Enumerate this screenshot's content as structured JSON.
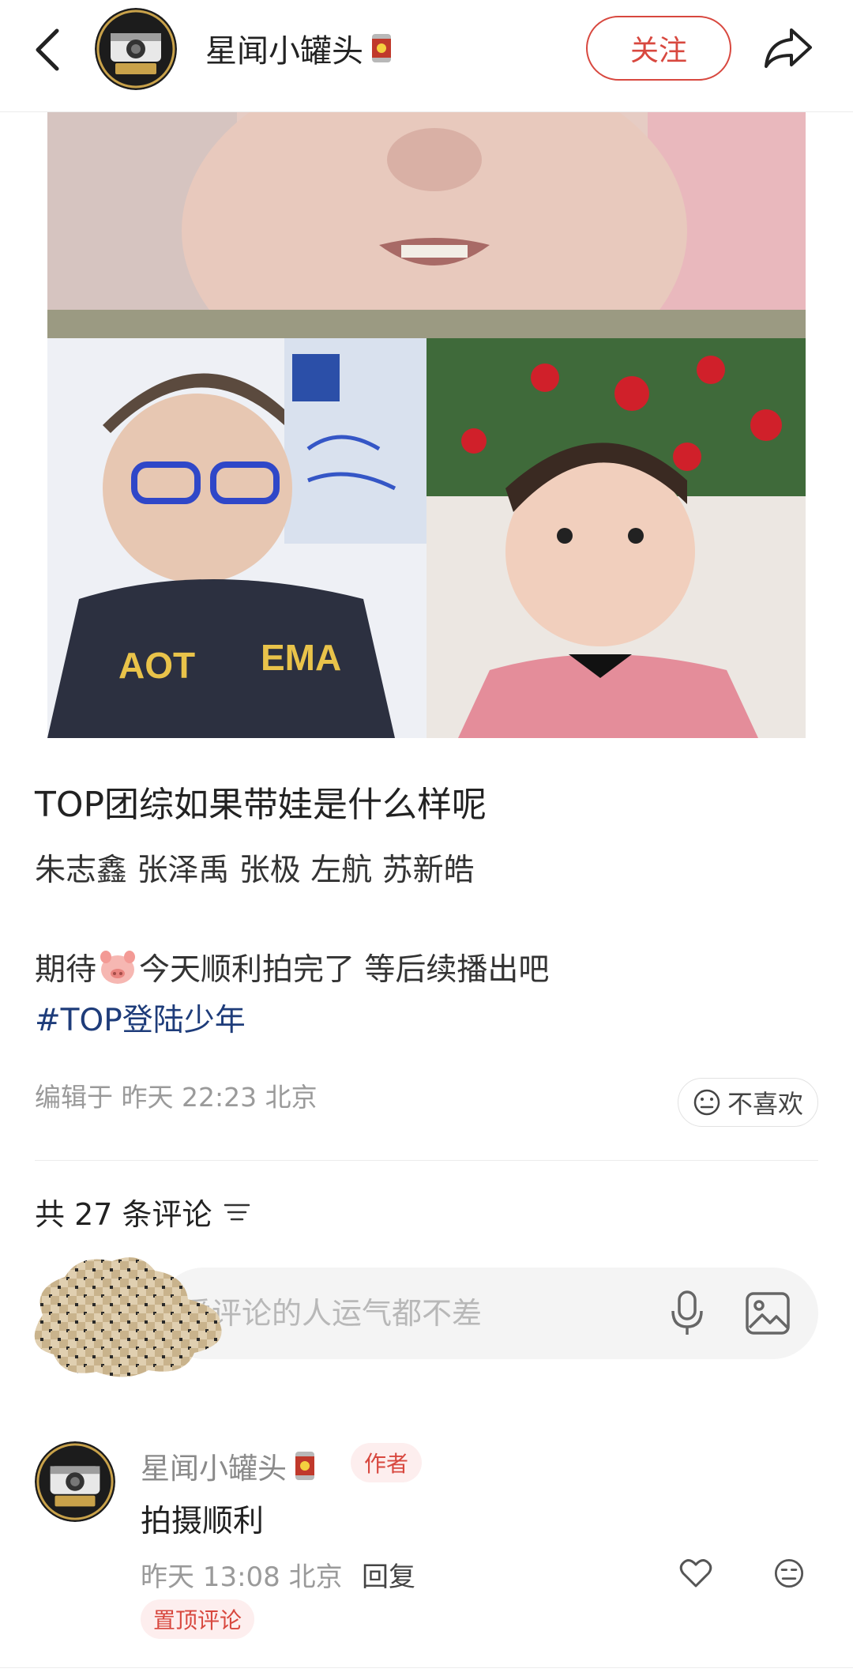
{
  "header": {
    "author_name": "星闻小罐头",
    "follow_label": "关注",
    "avatar_text": "星闻小罐头"
  },
  "post": {
    "title": "TOP团综如果带娃是什么样呢",
    "line1": "朱志鑫 张泽禹 张极 左航 苏新皓",
    "line2_before": "期待",
    "line2_after": "今天顺利拍完了 等后续播出吧",
    "hashtag": "#TOP登陆少年",
    "meta": "编辑于 昨天 22:23 北京",
    "dislike_label": "不喜欢"
  },
  "comments_section": {
    "count_label": "共 27 条评论",
    "input_placeholder": "爱评论的人运气都不差"
  },
  "comment": {
    "author": "星闻小罐头",
    "author_badge": "作者",
    "text": "拍摄顺利",
    "meta": "昨天 13:08 北京",
    "reply_label": "回复",
    "pinned_label": "置顶评论"
  },
  "colors": {
    "accent": "#d8483f",
    "hashtag": "#1e3c7a",
    "muted": "#9a9a9a"
  }
}
